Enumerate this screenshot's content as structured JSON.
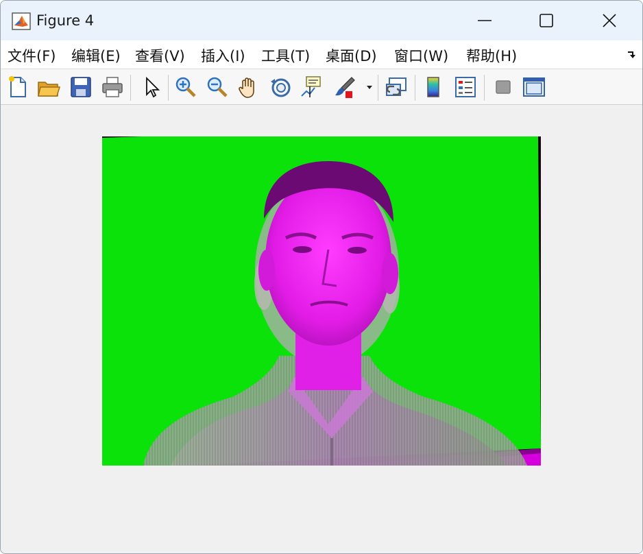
{
  "window": {
    "title": "Figure 4"
  },
  "menu": {
    "items": [
      {
        "label": "文件(F)",
        "name": "menu-file"
      },
      {
        "label": "编辑(E)",
        "name": "menu-edit"
      },
      {
        "label": "查看(V)",
        "name": "menu-view"
      },
      {
        "label": "插入(I)",
        "name": "menu-insert"
      },
      {
        "label": "工具(T)",
        "name": "menu-tools"
      },
      {
        "label": "桌面(D)",
        "name": "menu-desktop"
      },
      {
        "label": "窗口(W)",
        "name": "menu-window"
      },
      {
        "label": "帮助(H)",
        "name": "menu-help"
      }
    ]
  },
  "toolbar": {
    "buttons": [
      "new-figure-icon",
      "open-file-icon",
      "save-icon",
      "print-icon",
      "select-arrow-icon",
      "zoom-in-icon",
      "zoom-out-icon",
      "pan-hand-icon",
      "rotate-3d-icon",
      "data-cursor-icon",
      "brush-icon",
      "brush-dropdown-icon",
      "link-plot-icon",
      "colorbar-icon",
      "legend-icon",
      "hide-plot-tools-icon",
      "show-plot-tools-icon"
    ]
  },
  "image": {
    "description_colors": {
      "background": "#06e006",
      "subject": "#ff00ff",
      "border": "#1a0010"
    }
  },
  "colors": {
    "titlebar": "#eaf3fb",
    "menubar": "#ffffff",
    "canvas": "#f0f0f0"
  }
}
